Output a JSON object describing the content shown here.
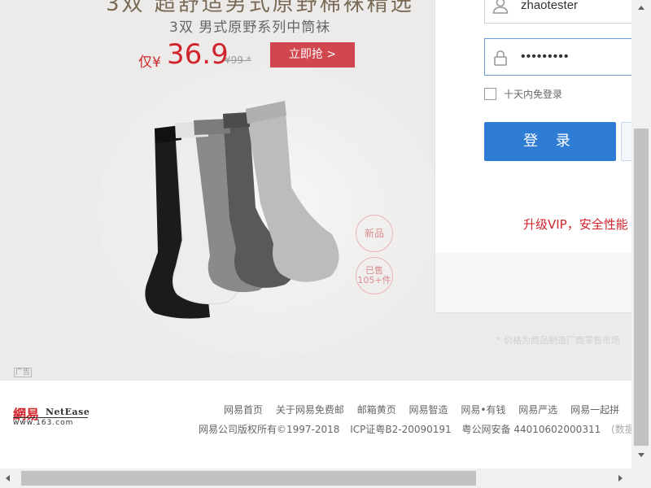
{
  "banner": {
    "title_partial": "3双 超舒适男式原野棉袜精选",
    "subtitle": "3双 男式原野系列中筒袜",
    "price_prefix": "仅¥",
    "price": "36.9",
    "original_price": "¥99 *",
    "buy_button": "立即抢 >",
    "badge_new": "新品",
    "badge_sold_line1": "已售",
    "badge_sold_line2": "105+件",
    "ad_tag": "广告",
    "price_note": "* 价格为商品制造厂商零售市场",
    "product_image": "socks-image"
  },
  "login": {
    "username": "zhaotester",
    "password_mask": "•••••••••",
    "remember_label": "十天内免登录",
    "login_button": "登 录",
    "vip_promo": "升级VIP，安全性能",
    "icons": {
      "user": "user-icon",
      "lock": "lock-icon"
    }
  },
  "footer": {
    "logo_cn": "網易",
    "logo_en": "NetEase",
    "logo_url": "www.163.com",
    "links": [
      "网易首页",
      "关于网易免费邮",
      "邮箱黄页",
      "网易智造",
      "网易•有钱",
      "网易严选",
      "网易一起拼"
    ],
    "copyright": "网易公司版权所有©1997-2018",
    "icp": "ICP证粤B2-20090191",
    "police": "粤公网安备 44010602000311",
    "data_source": "(数据来源"
  },
  "colors": {
    "brand_red": "#d0252c",
    "login_blue": "#2f7cd4"
  }
}
